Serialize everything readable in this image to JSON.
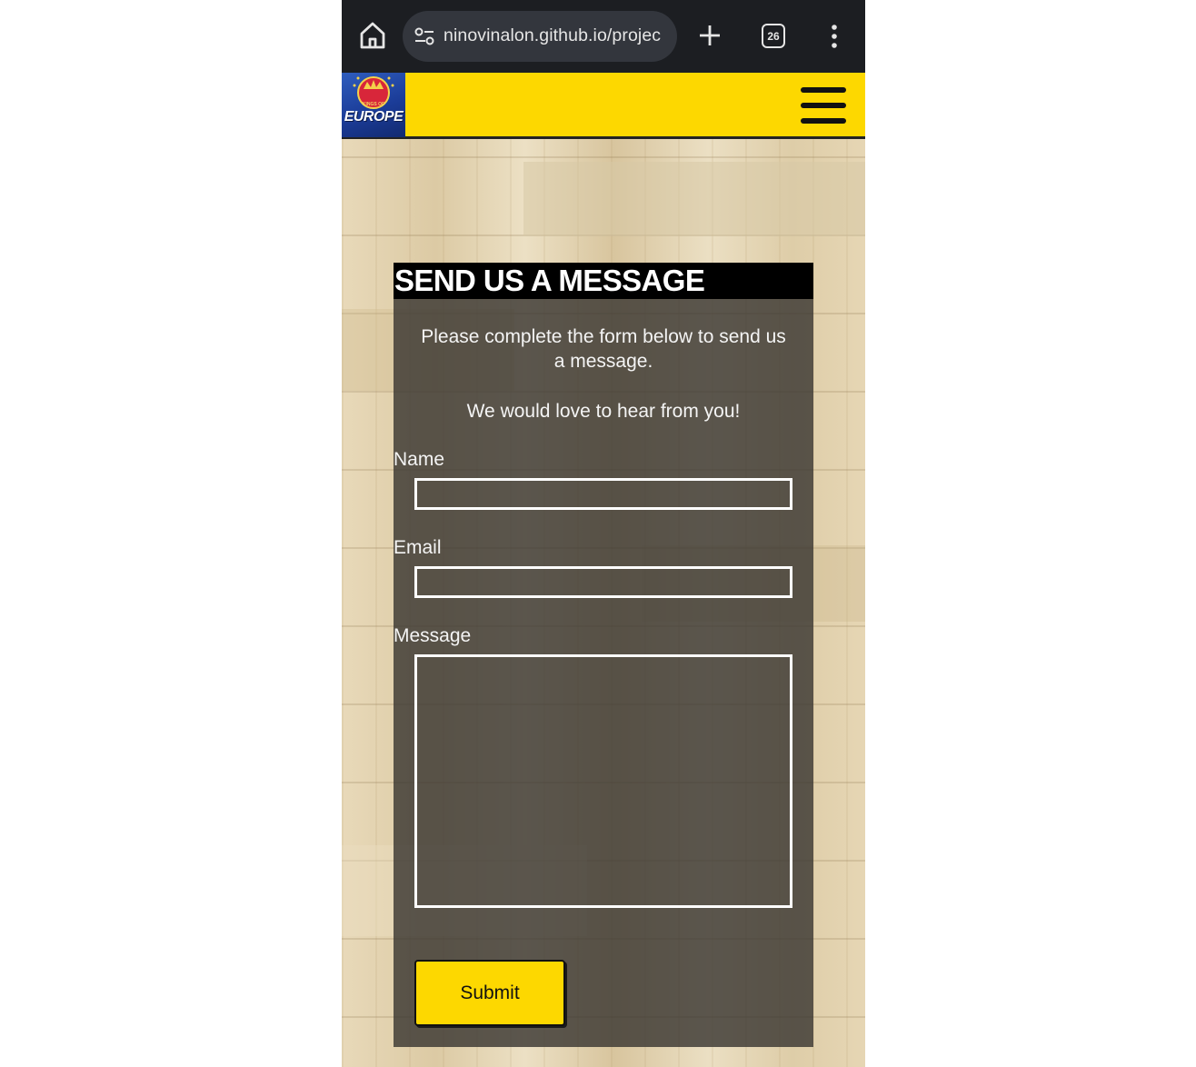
{
  "browser": {
    "url": "ninovinalon.github.io/projec",
    "tab_count": "26",
    "icons": {
      "home": "home-icon",
      "site_settings": "site-settings-icon",
      "new_tab": "plus-icon",
      "tabs": "tab-switcher-icon",
      "menu": "vertical-dots-icon"
    }
  },
  "header": {
    "logo_text": "EUROPE",
    "logo_subtext": "KINGS OF",
    "menu_icon": "hamburger-icon",
    "background_color": "#fdd800"
  },
  "form": {
    "title": "SEND US A MESSAGE",
    "intro_line1": "Please complete the form below to send us a message.",
    "intro_line2": "We would love to hear from you!",
    "name_label": "Name",
    "name_value": "",
    "email_label": "Email",
    "email_value": "",
    "message_label": "Message",
    "message_value": "",
    "submit_label": "Submit",
    "accent_color": "#fdd800"
  }
}
